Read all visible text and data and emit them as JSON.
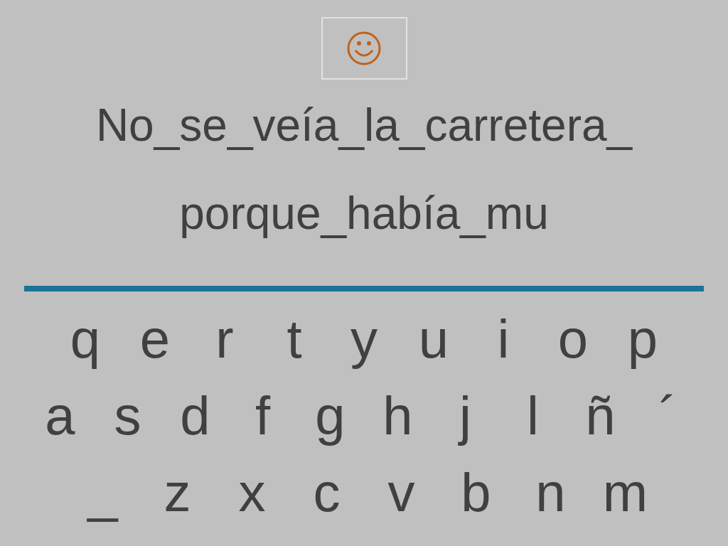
{
  "sentence_lines": [
    "No_se_veía_la_carretera_",
    "porque_había_mu"
  ],
  "keyboard": {
    "rows": [
      [
        "q",
        "e",
        "r",
        "t",
        "y",
        "u",
        "i",
        "o",
        "p"
      ],
      [
        "a",
        "s",
        "d",
        "f",
        "g",
        "h",
        "j",
        "l",
        "ñ",
        "´"
      ],
      [
        "_",
        "z",
        "x",
        "c",
        "v",
        "b",
        "n",
        "m"
      ]
    ]
  }
}
